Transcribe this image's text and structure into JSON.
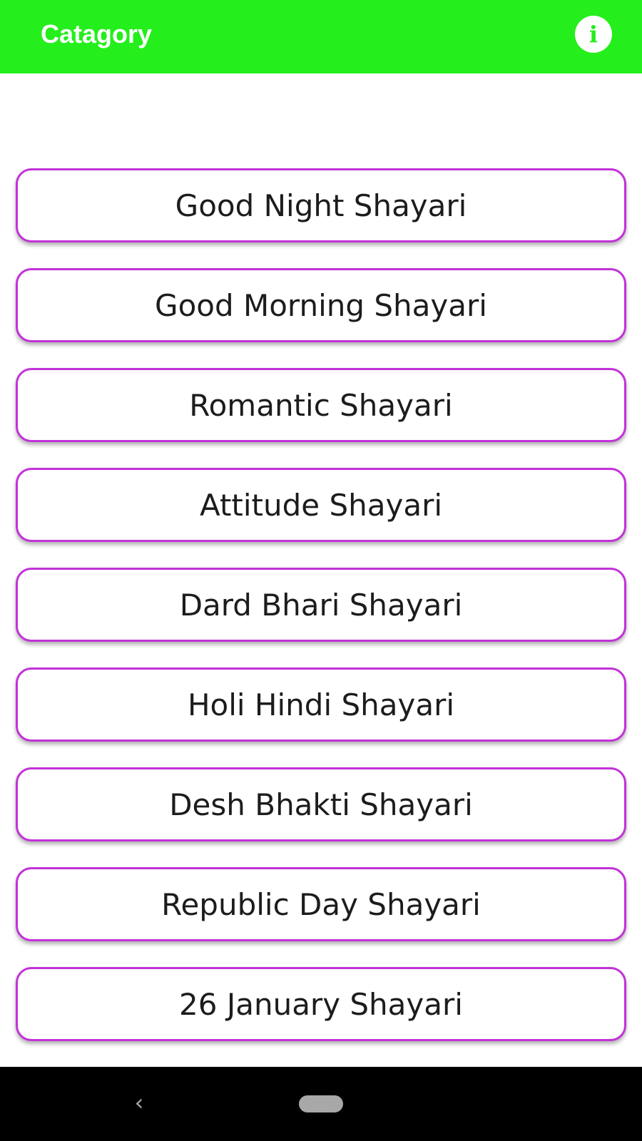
{
  "app_bar": {
    "title": "Catagory",
    "info_icon": "info-icon",
    "info_glyph": "i",
    "color": "#24ee1c"
  },
  "categories": [
    {
      "label": "Good Night Shayari"
    },
    {
      "label": "Good Morning Shayari"
    },
    {
      "label": "Romantic Shayari"
    },
    {
      "label": "Attitude Shayari"
    },
    {
      "label": "Dard Bhari Shayari"
    },
    {
      "label": "Holi Hindi Shayari"
    },
    {
      "label": "Desh Bhakti Shayari"
    },
    {
      "label": "Republic Day Shayari"
    },
    {
      "label": "26 January Shayari"
    }
  ],
  "nav_bar": {
    "back_icon": "back-icon",
    "back_glyph": "‹",
    "home_icon": "home-pill-icon"
  },
  "colors": {
    "accent": "#24ee1c",
    "item_border": "#c232d8"
  }
}
